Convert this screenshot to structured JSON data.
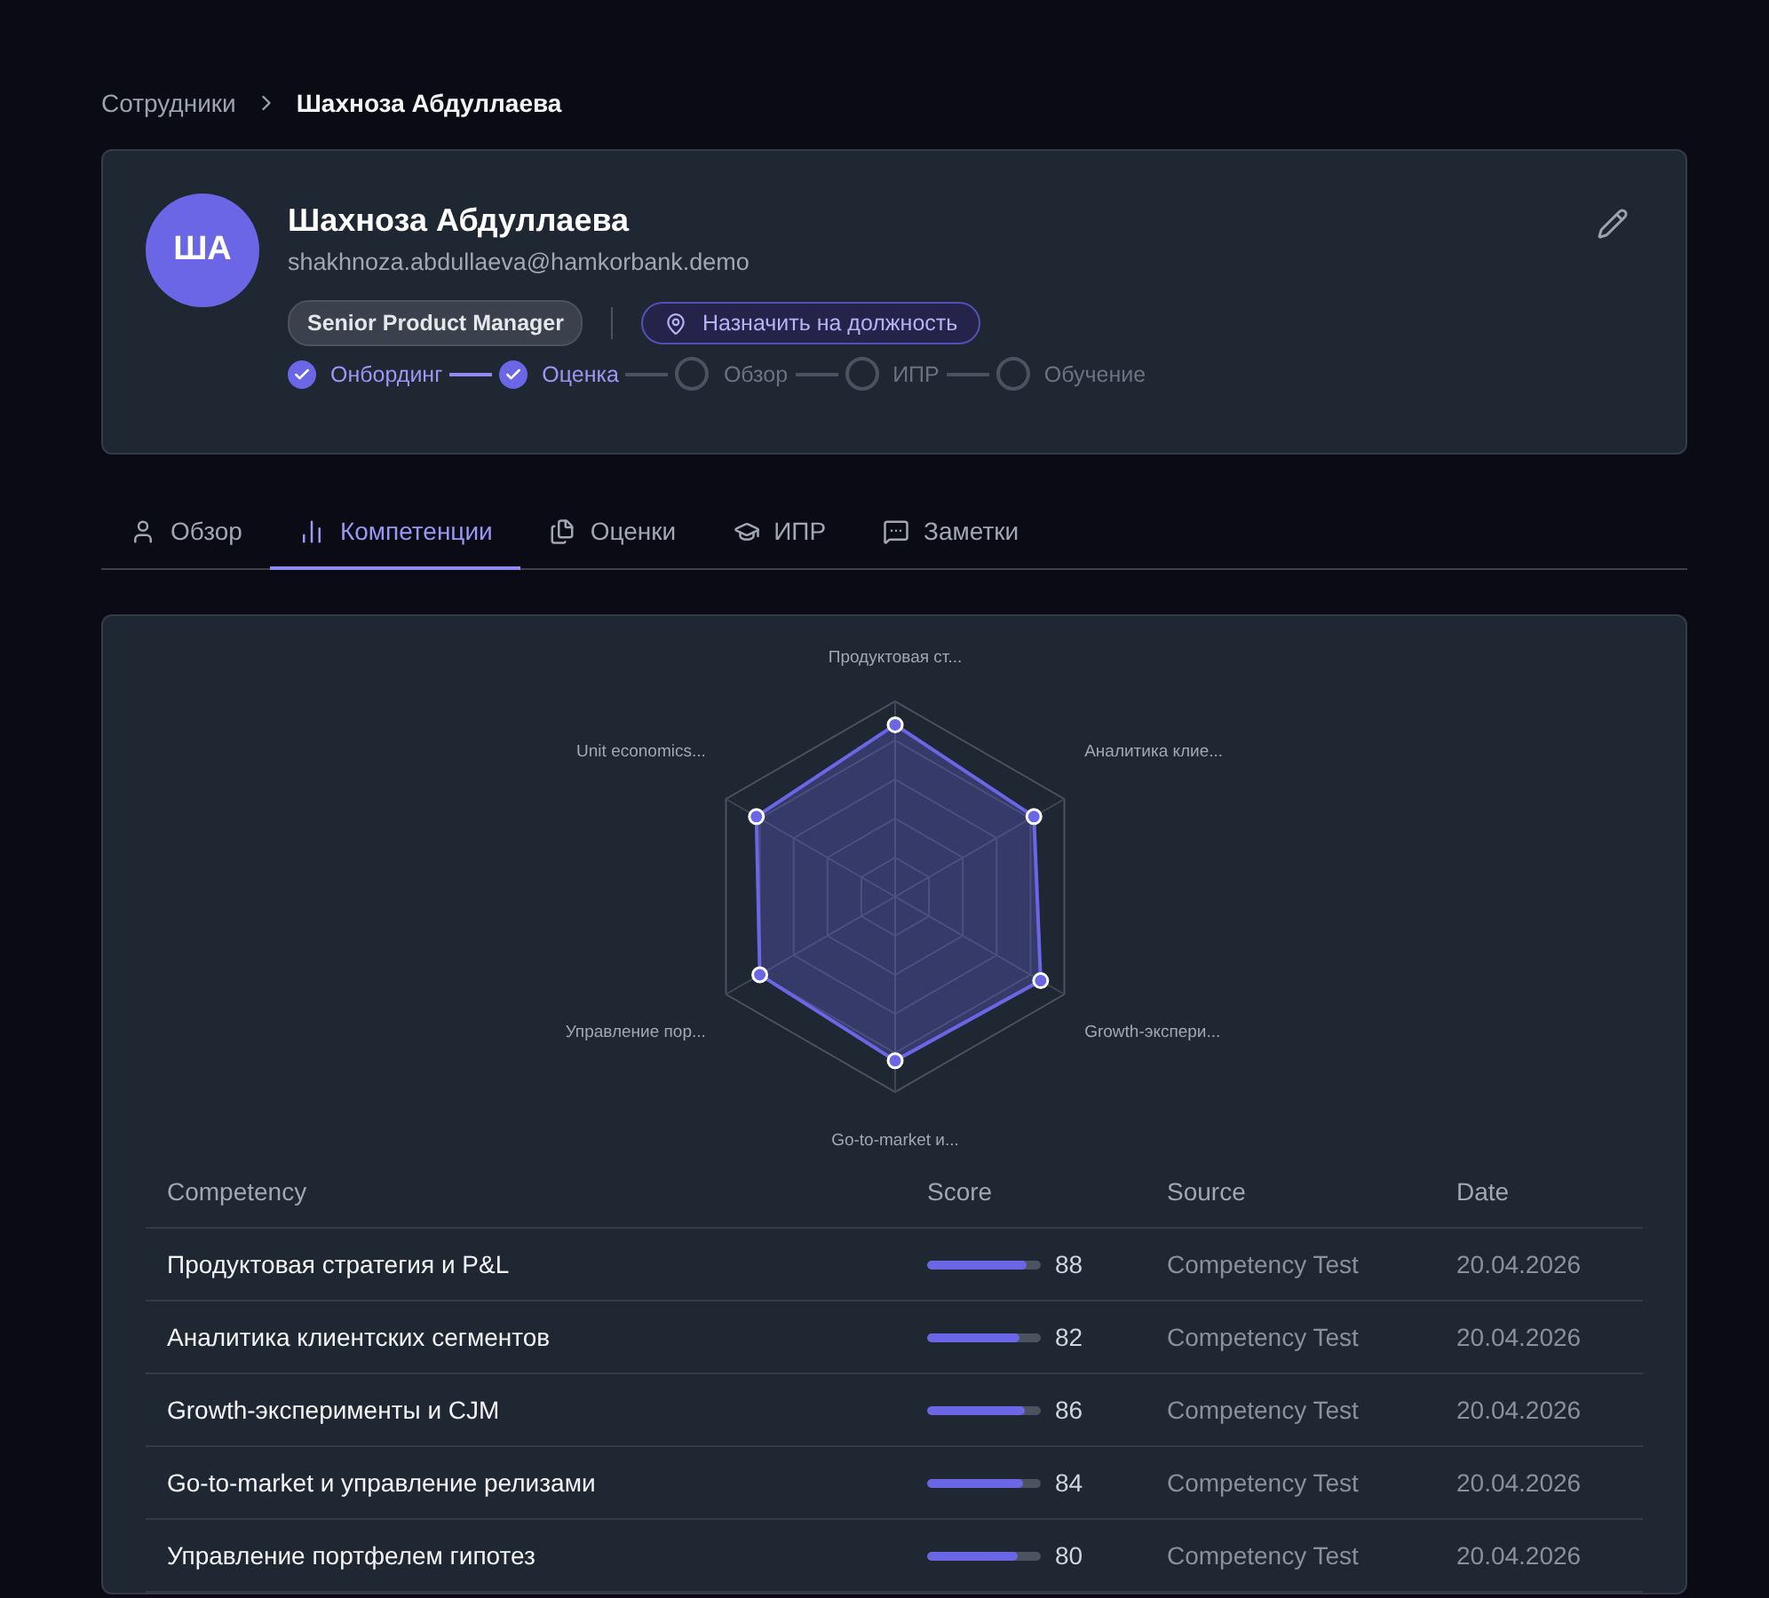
{
  "breadcrumb": [
    {
      "label": "Сотрудники",
      "current": false
    },
    {
      "label": "Шахноза Абдуллаева",
      "current": true
    }
  ],
  "profile": {
    "initials": "ША",
    "name": "Шахноза Абдуллаева",
    "email": "shakhnoza.abdullaeva@hamkorbank.demo",
    "position": "Senior Product Manager",
    "assign_button": "Назначить на должность",
    "steps": [
      {
        "label": "Онбординг",
        "done": true
      },
      {
        "label": "Оценка",
        "done": true
      },
      {
        "label": "Обзор",
        "done": false
      },
      {
        "label": "ИПР",
        "done": false
      },
      {
        "label": "Обучение",
        "done": false
      }
    ]
  },
  "tabs": [
    {
      "label": "Обзор",
      "selected": false
    },
    {
      "label": "Компетенции",
      "selected": true
    },
    {
      "label": "Оценки",
      "selected": false
    },
    {
      "label": "ИПР",
      "selected": false
    },
    {
      "label": "Заметки",
      "selected": false
    }
  ],
  "radar": {
    "axis_labels": [
      "Продуктовая ст...",
      "Unit economics...",
      "Аналитика клие...",
      "Управление пор...",
      "Growth-экспери...",
      "Go-to-market и..."
    ]
  },
  "table": {
    "columns": [
      "Competency",
      "Score",
      "Source",
      "Date"
    ],
    "rows": [
      {
        "competency": "Продуктовая стратегия и P&L",
        "level": 0.88,
        "score": "88",
        "source": "Competency Test",
        "date": "20.04.2026"
      },
      {
        "competency": "Аналитика клиентских сегментов",
        "level": 0.82,
        "score": "82",
        "source": "Competency Test",
        "date": "20.04.2026"
      },
      {
        "competency": "Growth-эксперименты и CJM",
        "level": 0.86,
        "score": "86",
        "source": "Competency Test",
        "date": "20.04.2026"
      },
      {
        "competency": "Go-to-market и управление релизами",
        "level": 0.84,
        "score": "84",
        "source": "Competency Test",
        "date": "20.04.2026"
      },
      {
        "competency": "Управление портфелем гипотез",
        "level": 0.8,
        "score": "80",
        "source": "Competency Test",
        "date": "20.04.2026"
      }
    ]
  }
}
